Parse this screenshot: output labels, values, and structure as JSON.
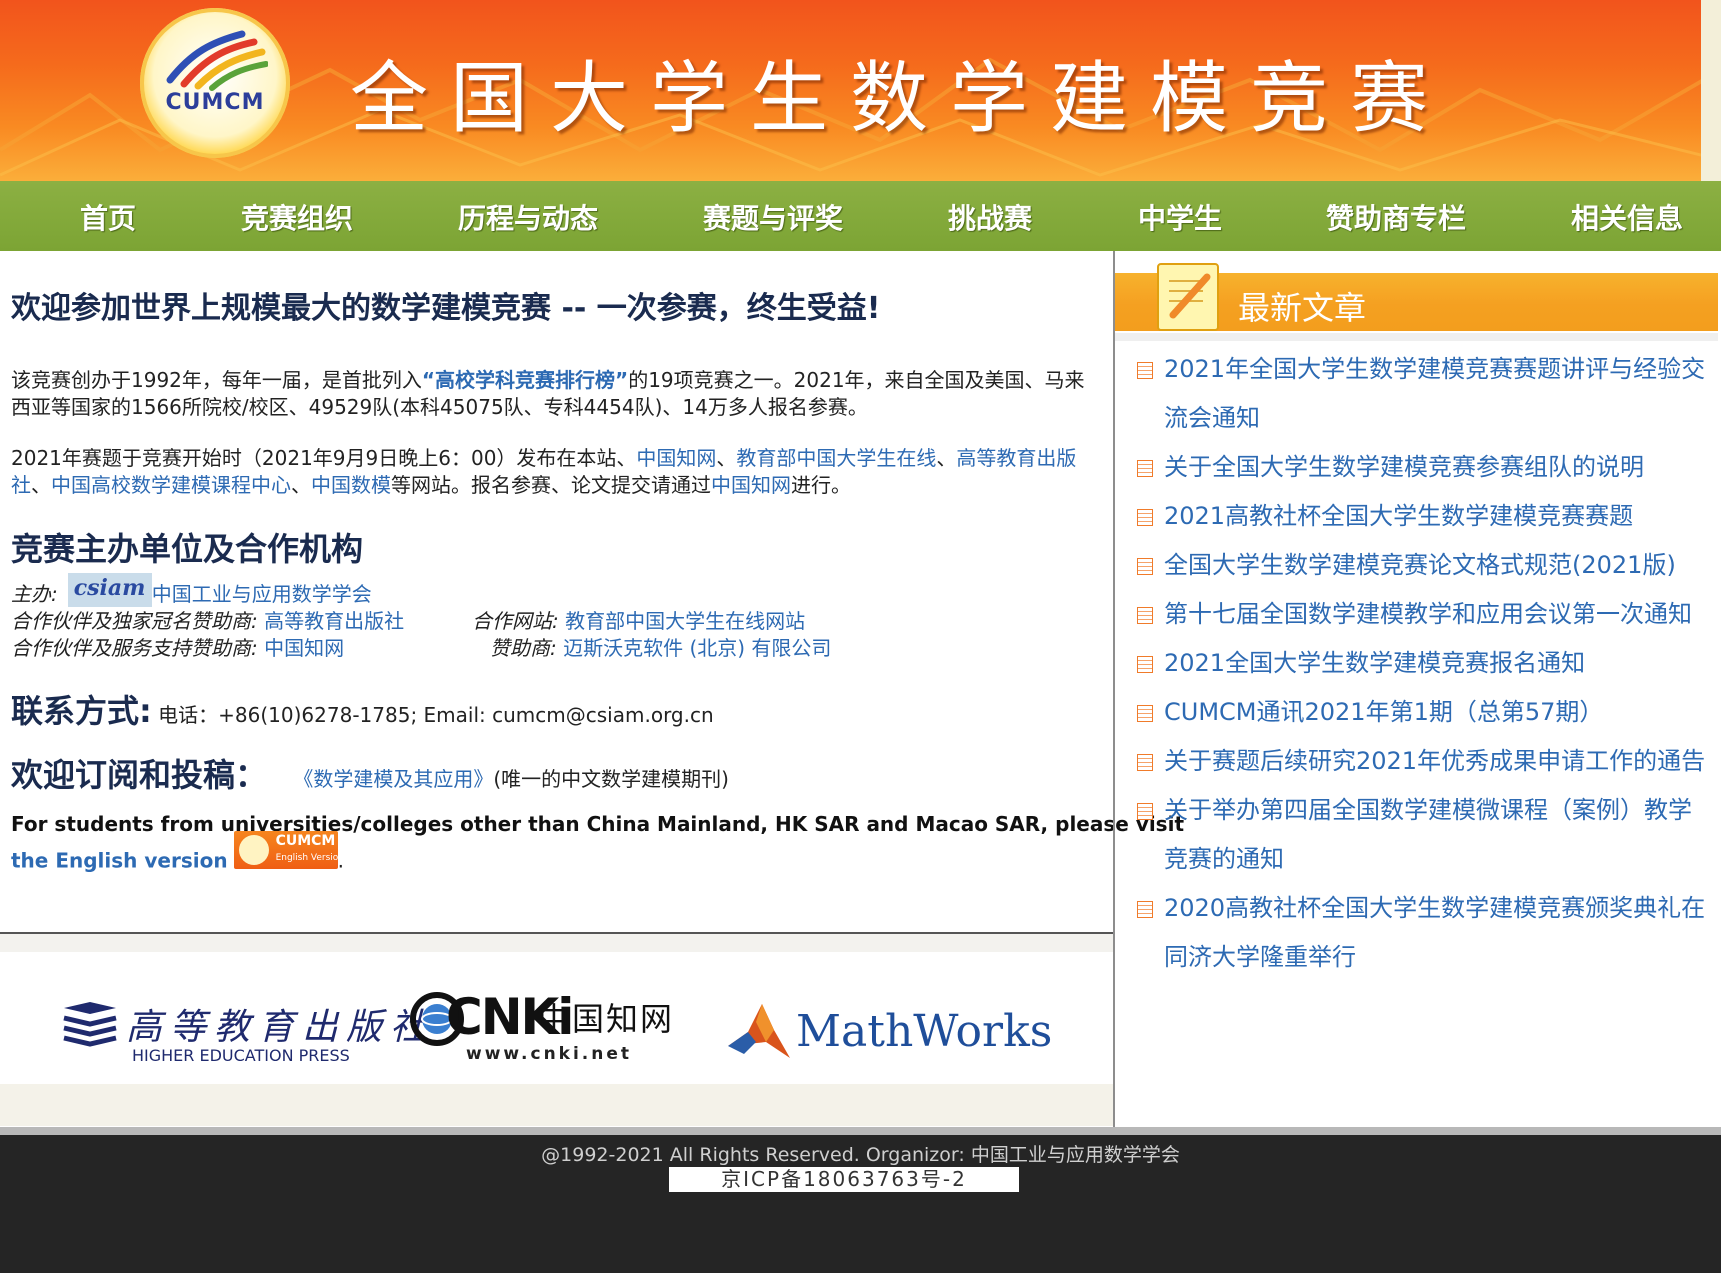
{
  "header": {
    "logo_text": "CUMCM",
    "title": "全国大学生数学建模竞赛"
  },
  "nav": [
    "首页",
    "竞赛组织",
    "历程与动态",
    "赛题与评奖",
    "挑战赛",
    "中学生",
    "赞助商专栏",
    "相关信息"
  ],
  "main": {
    "headline": "欢迎参加世界上规模最大的数学建模竞赛 -- 一次参赛，终生受益!",
    "intro": {
      "pre": "该竞赛创办于1992年，每年一届，是首批列入",
      "ranking_link": "“高校学科竞赛排行榜”",
      "post": "的19项竞赛之一。2021年，来自全国及美国、马来西亚等国家的1566所院校/校区、49529队(本科45075队、专科4454队)、14万多人报名参赛。"
    },
    "release": {
      "pre": "2021年赛题于竞赛开始时（2021年9月9日晚上6：00）发布在本站、",
      "link1": "中国知网",
      "sep1": "、",
      "link2": "教育部中国大学生在线",
      "sep2": "、",
      "link3": "高等教育出版社",
      "sep3": "、",
      "link4": "中国高校数学建模课程中心",
      "sep4": "、",
      "link5": "中国数模",
      "mid": "等网站。报名参赛、论文提交请通过",
      "link6": "中国知网",
      "post": "进行。"
    },
    "organizers_heading": "竞赛主办单位及合作机构",
    "host_label": "主办:",
    "csiam_logo_text": "csiam",
    "host_name": "中国工业与应用数学学会",
    "partner1_label": "合作伙伴及独家冠名赞助商:",
    "partner1_name": "高等教育出版社",
    "partner_site_label": "合作网站:",
    "partner_site_name": "教育部中国大学生在线网站",
    "partner2_label": "合作伙伴及服务支持赞助商:",
    "partner2_name": "中国知网",
    "sponsor_label": "赞助商:",
    "sponsor_name": "迈斯沃克软件 (北京) 有限公司",
    "contact_heading": "联系方式:",
    "contact_text": "电话：+86(10)6278-1785; Email: cumcm@csiam.org.cn",
    "subscribe_heading": "欢迎订阅和投稿：",
    "journal_link": "《数学建模及其应用》",
    "journal_note": "(唯一的中文数学建模期刊)",
    "english_note": "For students from universities/colleges other than China Mainland, HK SAR and Macao SAR, please visit",
    "english_link": "the English version",
    "english_badge_line1": "CUMCM",
    "english_badge_line2": "English Version",
    "english_trailing": "."
  },
  "sponsors": {
    "hep_cn": "高等教育出版社",
    "hep_en": "HIGHER EDUCATION PRESS",
    "cnki_word": "CNKi",
    "cnki_cn": "中国知网",
    "cnki_url": "www.cnki.net",
    "mathworks": "MathWorks"
  },
  "sidebar": {
    "title": "最新文章",
    "items": [
      "2021年全国大学生数学建模竞赛赛题讲评与经验交流会通知",
      "关于全国大学生数学建模竞赛参赛组队的说明",
      "2021高教社杯全国大学生数学建模竞赛赛题",
      "全国大学生数学建模竞赛论文格式规范(2021版)",
      "第十七届全国数学建模教学和应用会议第一次通知",
      "2021全国大学生数学建模竞赛报名通知",
      "CUMCM通讯2021年第1期（总第57期）",
      "关于赛题后续研究2021年优秀成果申请工作的通告",
      "关于举办第四届全国数学建模微课程（案例）教学竞赛的通知",
      "2020高教社杯全国大学生数学建模竞赛颁奖典礼在同济大学隆重举行"
    ]
  },
  "footer": {
    "copyright": "@1992-2021 All Rights Reserved.   Organizor: 中国工业与应用数学学会",
    "icp": "京ICP备18063763号-2"
  },
  "colors": {
    "banner_orange": "#f56a1c",
    "nav_green": "#7ca434",
    "link_blue": "#2d6ab3",
    "heading_navy": "#1a2b4f",
    "sidebar_header_orange": "#f5a021",
    "footer_dark": "#252525"
  }
}
